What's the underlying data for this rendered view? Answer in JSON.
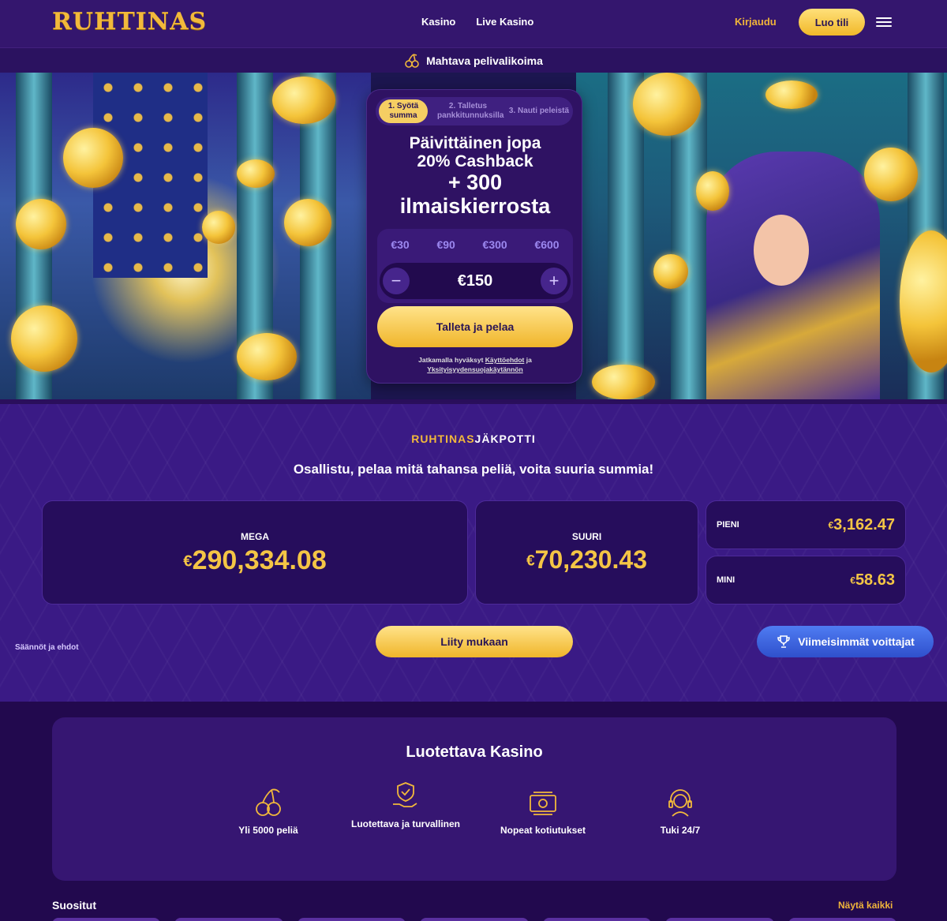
{
  "header": {
    "logo": "RUHTINAS",
    "nav": [
      "Kasino",
      "Live Kasino"
    ],
    "login": "Kirjaudu",
    "signup": "Luo tili"
  },
  "strip": {
    "text": "Mahtava pelivalikoima"
  },
  "card": {
    "steps": [
      "1. Syötä summa",
      "2. Talletus pankkitunnuksilla",
      "3. Nauti peleistä"
    ],
    "offer_line1": "Päivittäinen jopa",
    "offer_line2": "20% Cashback",
    "offer_line3": "+ 300",
    "offer_line4": "ilmaiskierrosta",
    "chips": [
      "€30",
      "€90",
      "€300",
      "€600"
    ],
    "amount": "€150",
    "minus": "−",
    "plus": "+",
    "deposit_button": "Talleta ja pelaa",
    "terms_prefix": "Jatkamalla hyväksyt ",
    "terms_link": "Käyttöehdot",
    "terms_and": " ja ",
    "privacy_link": "Yksityisyydensuojakäytännön"
  },
  "jackpot": {
    "logo_a": "RUHTINAS",
    "logo_b": "JÄKPOTTI",
    "subtitle": "Osallistu, pelaa mitä tahansa peliä, voita suuria summia!",
    "currency": "€",
    "mega_label": "MEGA",
    "mega_value": "290,334.08",
    "suuri_label": "SUURI",
    "suuri_value": "70,230.43",
    "pieni_label": "PIENI",
    "pieni_value": "3,162.47",
    "mini_label": "MINI",
    "mini_value": "58.63",
    "join_button": "Liity mukaan",
    "winners_button": "Viimeisimmät voittajat",
    "rules_link": "Säännöt ja ehdot"
  },
  "trust": {
    "title": "Luotettava Kasino",
    "features": [
      "Yli 5000 peliä",
      "Luotettava ja turvallinen",
      "Nopeat kotiutukset",
      "Tuki 24/7"
    ]
  },
  "popular": {
    "title": "Suositut",
    "show_all": "Näytä kaikki"
  },
  "colors": {
    "gold": "#f2b93b",
    "purple": "#34166e",
    "blue": "#3f63e0"
  }
}
